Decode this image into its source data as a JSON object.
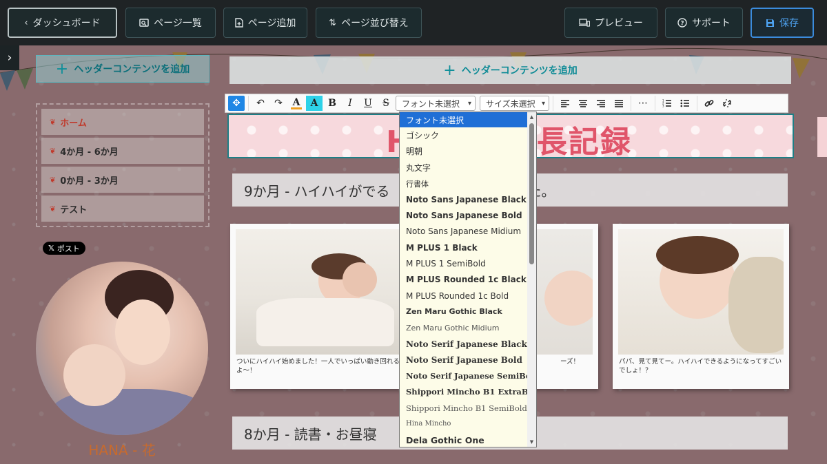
{
  "topbar": {
    "dashboard": "ダッシュボード",
    "page_list": "ページ一覧",
    "add_page": "ページ追加",
    "sort_pages": "ページ並び替え",
    "preview": "プレビュー",
    "support": "サポート",
    "save": "保存"
  },
  "header_add": {
    "left_label": "ヘッダーコンテンツを追加",
    "main_label": "ヘッダーコンテンツを追加"
  },
  "nav": {
    "items": [
      {
        "label": "ホーム",
        "active": true
      },
      {
        "label": "4か月 - 6か月"
      },
      {
        "label": "0か月 - 3か月"
      },
      {
        "label": "テスト"
      }
    ]
  },
  "social": {
    "post_label": "ポスト"
  },
  "profile": {
    "name": "HANA - 花"
  },
  "title": {
    "text_start": "H",
    "text_end": "長記録"
  },
  "sections": [
    {
      "start": "9か月 - ハイハイがでる",
      "end": "た。"
    },
    {
      "start": "8か月 - 読書・お昼寝",
      "end": "き"
    }
  ],
  "cards": [
    {
      "caption": "ついにハイハイ始めました！一人でいっぱい動き回れるよ～！"
    },
    {
      "caption": "ーズ！"
    },
    {
      "caption": "パパ、見て見てー。ハイハイできるようになってすごいでしょ！？"
    }
  ],
  "editor": {
    "font_select": "フォント未選択",
    "size_select": "サイズ未選択",
    "font_options": [
      "フォント未選択",
      "ゴシック",
      "明朝",
      "丸文字",
      "行書体",
      "Noto Sans Japanese Black",
      "Noto Sans Japanese Bold",
      "Noto Sans Japanese Midium",
      "M PLUS 1 Black",
      "M PLUS 1 SemiBold",
      "M PLUS Rounded 1c Black",
      "M PLUS Rounded 1c Bold",
      "Zen Maru Gothic Black",
      "Zen Maru Gothic Midium",
      "Noto Serif Japanese Black",
      "Noto Serif Japanese Bold",
      "Noto Serif Japanese SemiBold",
      "Shippori Mincho B1 ExtraBold",
      "Shippori Mincho B1 SemiBold",
      "Hina Mincho",
      "Dela Gothic One"
    ]
  },
  "colors": {
    "accent": "#1f87e5",
    "save": "#3b8bdc",
    "teal": "#0e8b96",
    "title": "#e0556a"
  }
}
